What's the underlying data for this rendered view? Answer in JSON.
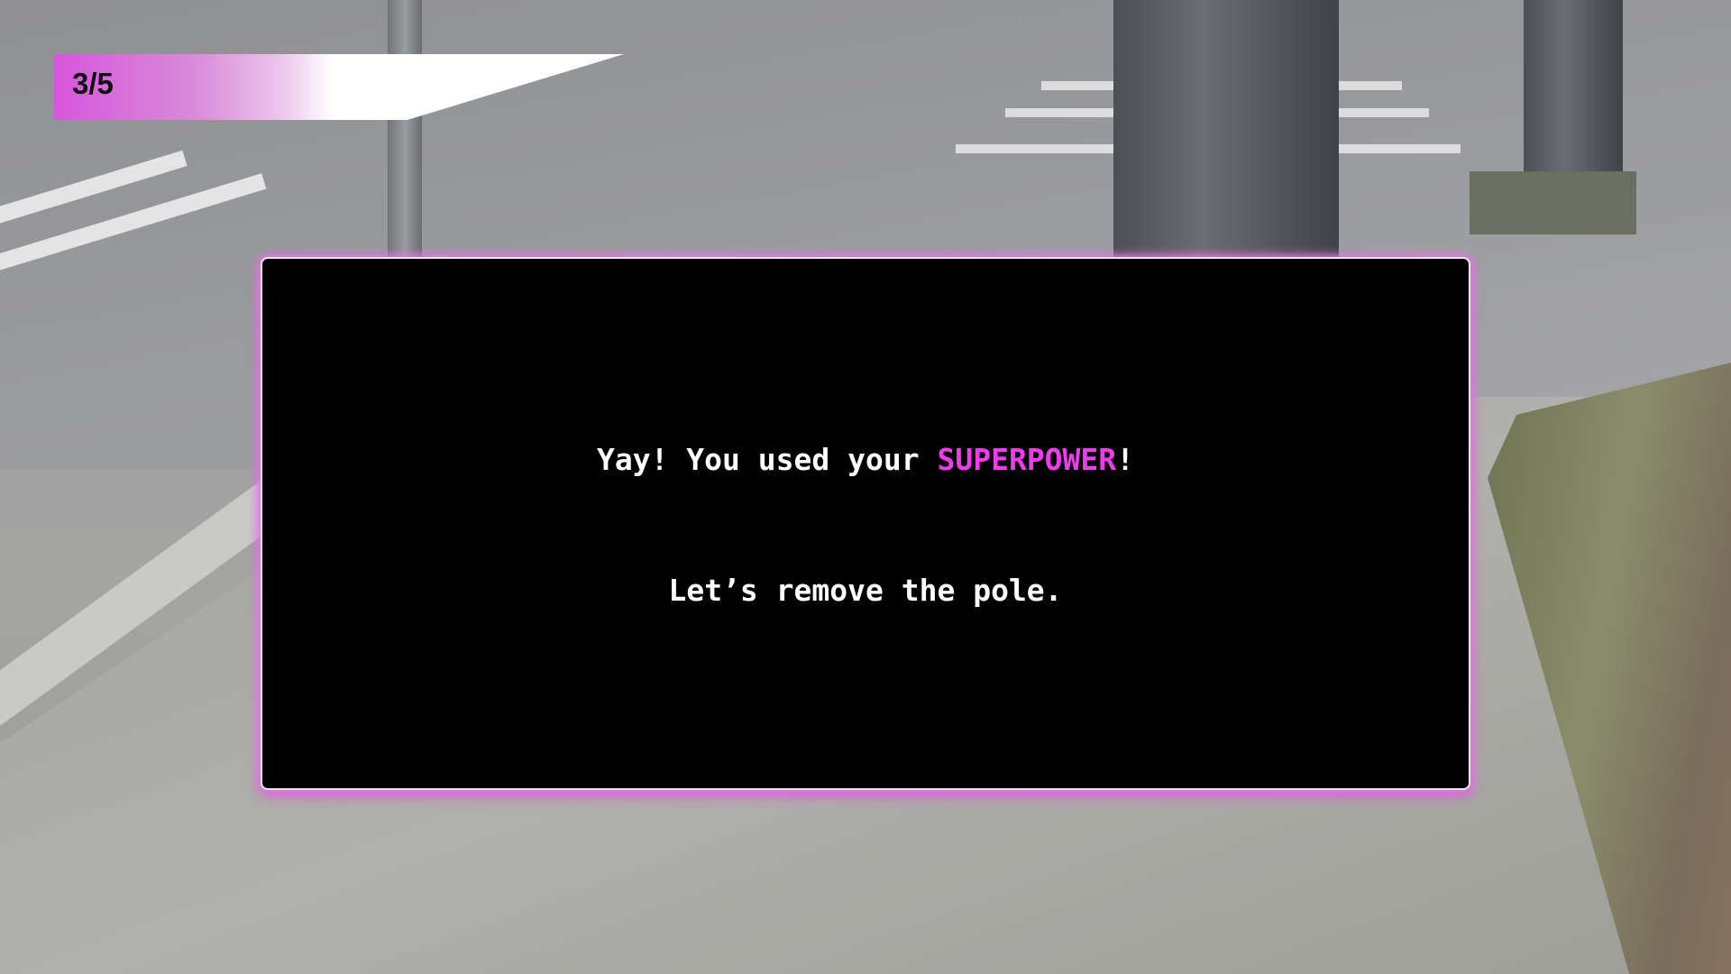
{
  "progress": {
    "label": "3/5",
    "current": 3,
    "total": 5
  },
  "dialog": {
    "line1_before": "Yay! You used your ",
    "line1_highlight": "SUPERPOWER",
    "line1_after": "!",
    "line2": "Let’s remove the pole."
  },
  "colors": {
    "accent": "#ee3bee",
    "card_bg": "#000000",
    "text": "#ffffff"
  }
}
